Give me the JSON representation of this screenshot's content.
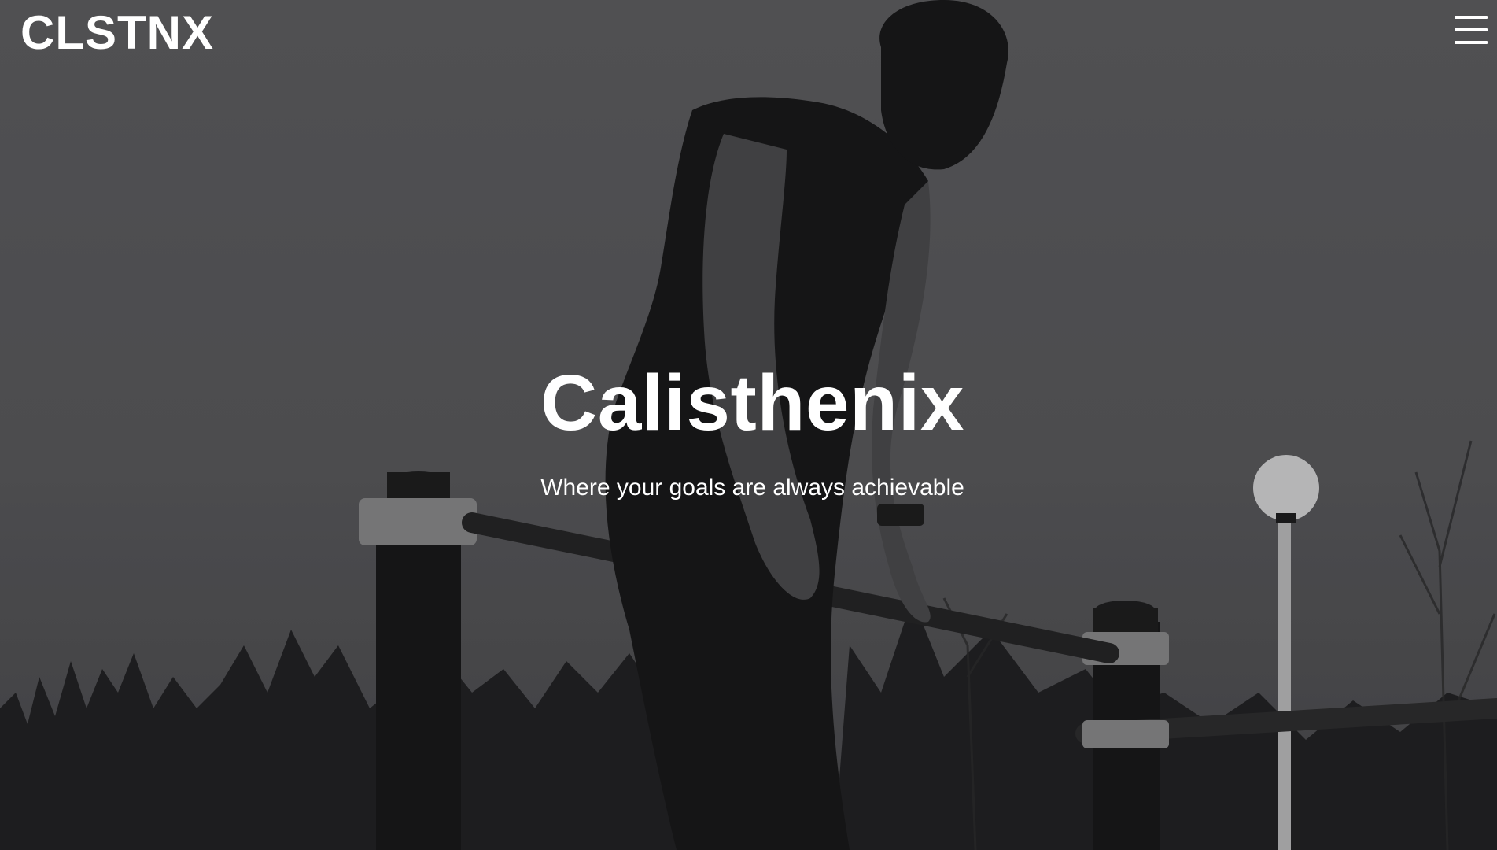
{
  "header": {
    "brand": "CLSTNX",
    "menu_icon": "hamburger-menu-icon"
  },
  "hero": {
    "title": "Calisthenix",
    "subtitle": "Where your goals are always achievable",
    "background": "grayscale photo of a man performing a dip on outdoor parallel bars"
  },
  "colors": {
    "text": "#ffffff",
    "overlay": "#3a3a3c"
  }
}
